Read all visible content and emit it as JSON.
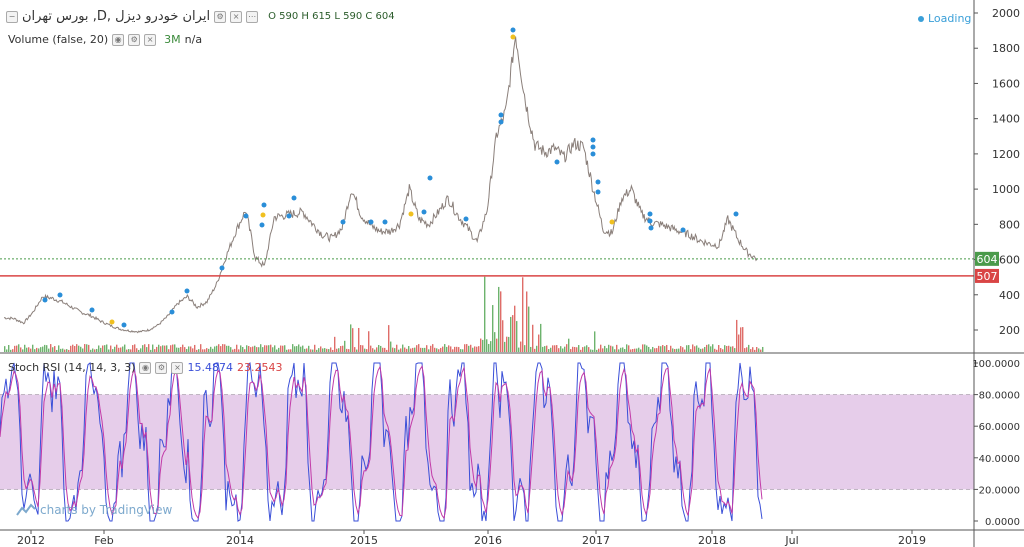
{
  "header": {
    "collapse_icon": "minus-square-icon",
    "symbol": "بورس تهران ,D, ایران خودرو دیزل",
    "ohlc": "O 590  H 615  L 590  C 604",
    "volume_label": "Volume (false, 20)",
    "volume_value": "3M",
    "volume_na": "n/a",
    "stoch_label": "Stoch RSI (14, 14, 3, 3)",
    "stoch_k": "15.4874",
    "stoch_d": "23.2543",
    "loading": "Loading"
  },
  "watermark": "charts by TradingView",
  "colors": {
    "up": "#53a653",
    "down": "#d9534f",
    "candle": "#8a7f7a",
    "k_line": "#3a4fd8",
    "d_line": "#c23ba8",
    "band": "#e3c8e8",
    "support": "#d94545",
    "last": "#4a9a4a",
    "dot": "#2a8ed8",
    "dot_alt": "#f0c020"
  },
  "chart_data": {
    "type": "line",
    "price_axis": {
      "ticks": [
        "2000",
        "1800",
        "1600",
        "1400",
        "1200",
        "1000",
        "800",
        "600",
        "400",
        "200"
      ],
      "ylim": [
        80,
        2000
      ]
    },
    "last_price": "604",
    "support_level": "507",
    "stoch_axis": {
      "ticks": [
        "100.0000",
        "80.0000",
        "60.0000",
        "40.0000",
        "20.0000",
        "0.0000"
      ],
      "ylim": [
        0,
        100
      ],
      "band": [
        20,
        80
      ]
    },
    "x_axis": {
      "ticks": [
        "2012",
        "Feb",
        "2014",
        "2015",
        "2016",
        "2017",
        "2018",
        "Jul",
        "2019"
      ]
    },
    "price_series": [
      [
        "2011-12",
        270
      ],
      [
        "2012-01",
        265
      ],
      [
        "2012-02",
        240
      ],
      [
        "2012-03",
        300
      ],
      [
        "2012-04",
        390
      ],
      [
        "2012-05",
        380
      ],
      [
        "2012-06",
        360
      ],
      [
        "2012-07",
        330
      ],
      [
        "2012-08",
        300
      ],
      [
        "2012-09",
        280
      ],
      [
        "2012-10",
        250
      ],
      [
        "2012-11",
        225
      ],
      [
        "2012-12",
        205
      ],
      [
        "2013-01",
        195
      ],
      [
        "2013-02",
        190
      ],
      [
        "2013-03",
        200
      ],
      [
        "2013-04",
        230
      ],
      [
        "2013-05",
        280
      ],
      [
        "2013-06",
        350
      ],
      [
        "2013-07",
        390
      ],
      [
        "2013-08",
        330
      ],
      [
        "2013-09",
        360
      ],
      [
        "2013-10",
        460
      ],
      [
        "2013-11",
        620
      ],
      [
        "2013-12",
        760
      ],
      [
        "2014-01",
        880
      ],
      [
        "2014-02",
        610
      ],
      [
        "2014-03",
        560
      ],
      [
        "2014-04",
        840
      ],
      [
        "2014-05",
        850
      ],
      [
        "2014-06",
        860
      ],
      [
        "2014-07",
        870
      ],
      [
        "2014-08",
        800
      ],
      [
        "2014-09",
        740
      ],
      [
        "2014-10",
        720
      ],
      [
        "2014-11",
        780
      ],
      [
        "2014-12",
        1000
      ],
      [
        "2015-01",
        850
      ],
      [
        "2015-02",
        790
      ],
      [
        "2015-03",
        760
      ],
      [
        "2015-04",
        760
      ],
      [
        "2015-05",
        800
      ],
      [
        "2015-06",
        1000
      ],
      [
        "2015-07",
        830
      ],
      [
        "2015-08",
        800
      ],
      [
        "2015-09",
        870
      ],
      [
        "2015-10",
        950
      ],
      [
        "2015-11",
        850
      ],
      [
        "2015-12",
        780
      ],
      [
        "2016-01",
        700
      ],
      [
        "2016-02",
        880
      ],
      [
        "2016-03",
        1300
      ],
      [
        "2016-04",
        1450
      ],
      [
        "2016-05",
        1880
      ],
      [
        "2016-06",
        1500
      ],
      [
        "2016-07",
        1250
      ],
      [
        "2016-08",
        1210
      ],
      [
        "2016-09",
        1230
      ],
      [
        "2016-10",
        1180
      ],
      [
        "2016-11",
        1260
      ],
      [
        "2016-12",
        1240
      ],
      [
        "2017-01",
        1000
      ],
      [
        "2017-02",
        770
      ],
      [
        "2017-03",
        750
      ],
      [
        "2017-04",
        950
      ],
      [
        "2017-05",
        1000
      ],
      [
        "2017-06",
        860
      ],
      [
        "2017-07",
        810
      ],
      [
        "2017-08",
        800
      ],
      [
        "2017-09",
        780
      ],
      [
        "2017-10",
        760
      ],
      [
        "2017-11",
        740
      ],
      [
        "2017-12",
        710
      ],
      [
        "2018-01",
        690
      ],
      [
        "2018-02",
        680
      ],
      [
        "2018-03",
        830
      ],
      [
        "2018-04",
        720
      ],
      [
        "2018-05",
        640
      ],
      [
        "2018-06",
        604
      ]
    ]
  }
}
